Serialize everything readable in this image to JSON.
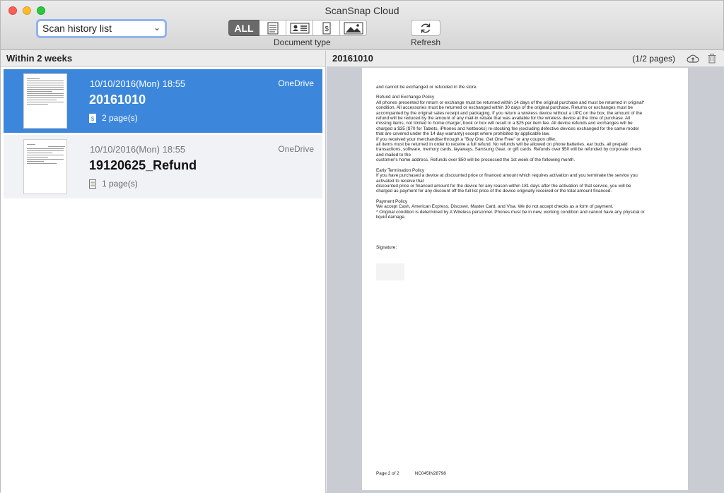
{
  "window": {
    "title": "ScanSnap Cloud"
  },
  "toolbar": {
    "view_select": {
      "value": "Scan history list"
    },
    "document_type": {
      "label": "Document type",
      "buttons": [
        {
          "name": "all",
          "label": "ALL",
          "active": true
        },
        {
          "name": "documents",
          "icon": "document-icon"
        },
        {
          "name": "business-cards",
          "icon": "business-card-icon"
        },
        {
          "name": "receipts",
          "icon": "receipt-icon"
        },
        {
          "name": "photos",
          "icon": "photo-icon"
        }
      ]
    },
    "refresh": {
      "label": "Refresh",
      "icon": "refresh-icon"
    }
  },
  "history": {
    "group_label": "Within 2 weeks",
    "items": [
      {
        "date": "10/10/2016(Mon) 18:55",
        "title": "20161010",
        "pages": "2 page(s)",
        "page_icon": "receipt-icon",
        "destination": "OneDrive",
        "selected": true
      },
      {
        "date": "10/10/2016(Mon) 18:55",
        "title": "19120625_Refund",
        "pages": "1 page(s)",
        "page_icon": "document-icon",
        "destination": "OneDrive",
        "selected": false
      }
    ]
  },
  "preview": {
    "title": "20161010",
    "page_count": "(1/2 pages)",
    "document": {
      "lines": [
        "and cannot be exchanged or refunded in the store.",
        "",
        "Refund and Exchange Policy",
        "All phones presented for return or exchange must be returned within 14 days of the original purchase and must be returned in original*",
        "condition.  All accessories must be returned or exchanged within 30 days of the original purchase.  Returns or exchanges must be",
        "accompanied by the original sales receipt and packaging.  If you return a wireless device without a UPC on the box, the amount of the",
        "refund will be reduced by the amount of any mail-in rebate that was available for the wireless device at the time of purchase.  All",
        "missing items, not limited to home charger, book or box will result in a $25 per item fee.  All device refunds and exchanges will be",
        "charged a $35 ($70 for Tablets, iPhones and Netbooks) re-stocking fee (excluding defective devices exchanged for the same model",
        "that are covered under the 14 day warranty) except where prohibited by applicable law.",
        "If you received your merchandise through a \"Buy One, Get One Free\" or any coupon offer,",
        "all items must be returned in order to receive a full refund.  No refunds will be allowed on phone batteries, ear buds, all prepaid",
        "transactions, software, memory cards, layaways, Samsung Gear, or gift cards.  Refunds over $50 will be refunded by corporate check",
        "and mailed to the",
        "customer's home address.  Refunds over $50 will be processed the 1st week of the following month.",
        "",
        "Early Termination Policy",
        "If you have purchased a device at discounted price or financed amount which requires activation and you terminate the service you",
        "activated to receive that",
        "discounted price or financed amount for the device for any reason within 181 days after the activation of that service, you will be",
        "charged as payment for any discount off the full list price of the device originally received or the total amount financed.",
        "",
        "Payment Policy",
        "We accept Cash, American Express, Discover, Master Card, and Visa.  We do not accept checks as a form of payment.",
        "* Original condition is determined by A Wireless personnel.  Phones must be in new, working condition and cannot have any physical or",
        "liquid damage."
      ],
      "signature_label": "Signature:",
      "footer_page": "Page 2 of 2",
      "footer_code": "NC045IN28798"
    }
  }
}
